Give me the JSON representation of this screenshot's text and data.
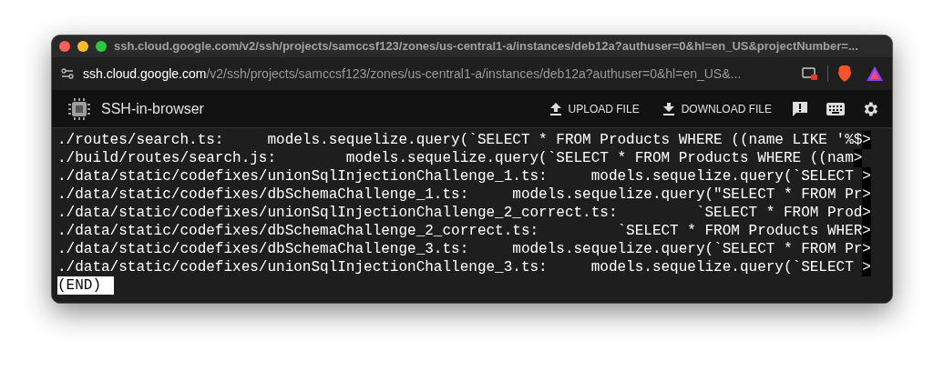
{
  "window": {
    "title": "ssh.cloud.google.com/v2/ssh/projects/samccsf123/zones/us-central1-a/instances/deb12a?authuser=0&hl=en_US&projectNumber=..."
  },
  "address_bar": {
    "host": "ssh.cloud.google.com",
    "path": "/v2/ssh/projects/samccsf123/zones/us-central1-a/instances/deb12a?authuser=0&hl=en_US&..."
  },
  "toolbar": {
    "app_name": "SSH-in-browser",
    "buttons": [
      {
        "label": "UPLOAD FILE",
        "kind": "upload"
      },
      {
        "label": "DOWNLOAD FILE",
        "kind": "download"
      }
    ]
  },
  "terminal": {
    "lines": [
      {
        "text": "./routes/search.ts:     models.sequelize.query(`SELECT * FROM Products WHERE ((name LIKE '%$",
        "marker": ">"
      },
      {
        "text": "./build/routes/search.js:        models.sequelize.query(`SELECT * FROM Products WHERE ((nam",
        "marker": ">"
      },
      {
        "text": "./data/static/codefixes/unionSqlInjectionChallenge_1.ts:     models.sequelize.query(`SELECT ",
        "marker": ">"
      },
      {
        "text": "./data/static/codefixes/dbSchemaChallenge_1.ts:     models.sequelize.query(\"SELECT * FROM Pr",
        "marker": ">"
      },
      {
        "text": "./data/static/codefixes/unionSqlInjectionChallenge_2_correct.ts:         `SELECT * FROM Prod",
        "marker": ">"
      },
      {
        "text": "./data/static/codefixes/dbSchemaChallenge_2_correct.ts:         `SELECT * FROM Products WHER",
        "marker": ">"
      },
      {
        "text": "./data/static/codefixes/dbSchemaChallenge_3.ts:     models.sequelize.query(`SELECT * FROM Pr",
        "marker": ">"
      },
      {
        "text": "./data/static/codefixes/unionSqlInjectionChallenge_3.ts:     models.sequelize.query(`SELECT ",
        "marker": ">"
      }
    ],
    "status": "(END)"
  }
}
